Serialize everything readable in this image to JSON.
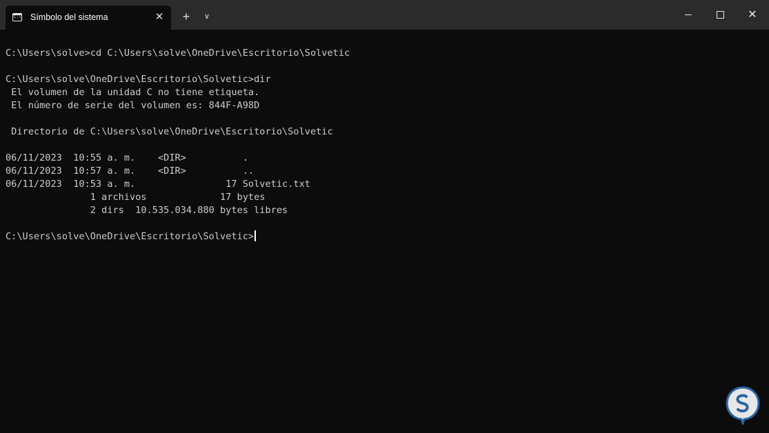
{
  "window": {
    "tab_title": "Símbolo del sistema",
    "tab_icon_prompt": "C:\\",
    "icons": {
      "tab": "terminal-icon",
      "close_tab": "close-icon",
      "new_tab": "plus-icon",
      "dropdown": "chevron-down-icon",
      "minimize": "minimize-icon",
      "maximize": "maximize-icon",
      "close": "close-icon"
    },
    "glyphs": {
      "close_tab": "✕",
      "new_tab": "+",
      "dropdown": "∨",
      "close": "✕"
    }
  },
  "terminal": {
    "lines": [
      "",
      "C:\\Users\\solve>cd C:\\Users\\solve\\OneDrive\\Escritorio\\Solvetic",
      "",
      "C:\\Users\\solve\\OneDrive\\Escritorio\\Solvetic>dir",
      " El volumen de la unidad C no tiene etiqueta.",
      " El número de serie del volumen es: 844F-A98D",
      "",
      " Directorio de C:\\Users\\solve\\OneDrive\\Escritorio\\Solvetic",
      "",
      "06/11/2023  10:55 a. m.    <DIR>          .",
      "06/11/2023  10:57 a. m.    <DIR>          ..",
      "06/11/2023  10:53 a. m.                17 Solvetic.txt",
      "               1 archivos             17 bytes",
      "               2 dirs  10.535.034.880 bytes libres",
      "",
      "C:\\Users\\solve\\OneDrive\\Escritorio\\Solvetic>"
    ]
  },
  "colors": {
    "background": "#0c0c0c",
    "titlebar": "#2b2b2b",
    "text": "#cccccc"
  },
  "watermark": {
    "name": "solvetic-logo",
    "color": "#2f6db5"
  }
}
